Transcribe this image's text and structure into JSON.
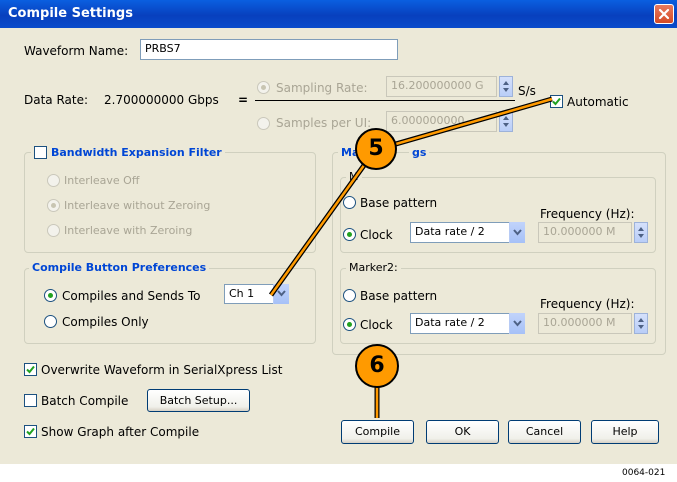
{
  "window": {
    "title": "Compile Settings"
  },
  "waveform_name": {
    "label": "Waveform Name:",
    "value": "PRBS7"
  },
  "data_rate": {
    "label": "Data Rate:",
    "value": "2.700000000 Gbps",
    "equals": "="
  },
  "sampling_rate": {
    "label": "Sampling Rate:",
    "value": "16.200000000 G",
    "unit": "S/s"
  },
  "samples_per_ui": {
    "label": "Samples per UI:",
    "value": "6.000000000"
  },
  "automatic": {
    "label": "Automatic",
    "checked": true
  },
  "bandwidth": {
    "label": "Bandwidth Expansion Filter",
    "options": [
      "Interleave Off",
      "Interleave without Zeroing",
      "Interleave with Zeroing"
    ],
    "selected": "Interleave without Zeroing"
  },
  "compile_prefs": {
    "label": "Compile Button Preferences",
    "option1": "Compiles and Sends To",
    "option2": "Compiles Only",
    "channel": "Ch 1"
  },
  "marker_settings": {
    "label_visible_start": "Ma",
    "label_visible_end": "gs",
    "marker1": {
      "label_visible": "M",
      "base_pattern": "Base pattern",
      "clock": "Clock",
      "clock_value": "Data rate / 2",
      "freq_label": "Frequency (Hz):",
      "freq_value": "10.000000 M"
    },
    "marker2": {
      "label": "Marker2:",
      "base_pattern": "Base pattern",
      "clock": "Clock",
      "clock_value": "Data rate / 2",
      "freq_label": "Frequency (Hz):",
      "freq_value": "10.000000 M"
    }
  },
  "options": {
    "overwrite": "Overwrite Waveform in SerialXpress List",
    "batch_compile": "Batch Compile",
    "batch_setup": "Batch Setup...",
    "show_graph": "Show Graph after Compile"
  },
  "buttons": {
    "compile": "Compile",
    "ok": "OK",
    "cancel": "Cancel",
    "help": "Help"
  },
  "callouts": {
    "c5": "5",
    "c6": "6"
  },
  "figure_id": "0064-021",
  "colors": {
    "title_bar": "#0840BE",
    "callout": "#FF9A00",
    "legend_blue": "#0046D5",
    "radio_dot": "#21A121"
  }
}
